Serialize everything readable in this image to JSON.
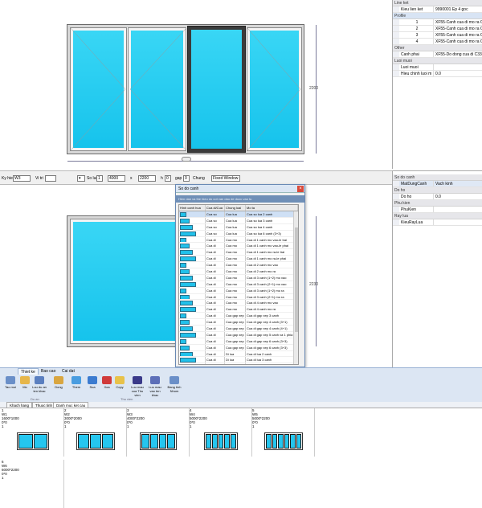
{
  "top_panel": {
    "dim_height": "2200",
    "dim_width_hint": "—"
  },
  "properties_top": {
    "cat_line": "Line ket",
    "rows1": [
      {
        "k": "Kieu lien ket",
        "v": "9990001  Ep 4 goc"
      }
    ],
    "cat_profile": "Profile",
    "rows2": [
      {
        "k": "1",
        "v": "XF55-Canh cua di mo ra  C"
      },
      {
        "k": "2",
        "v": "XF55-Canh cua di mo ra  C"
      },
      {
        "k": "3",
        "v": "XF55-Canh cua di mo ra  C"
      },
      {
        "k": "4",
        "v": "XF55-Canh cua di mo ra  C"
      }
    ],
    "cat_other": "Other",
    "rows3": [
      {
        "k": "Canh phai",
        "v": "XF55-Do dong cua di  C332"
      }
    ],
    "cat_luoi": "Luoi muoi",
    "rows4": [
      {
        "k": "Luoi muoi",
        "v": ""
      },
      {
        "k": "Hieu chinh luoi m",
        "v": "0.0"
      }
    ]
  },
  "toolbar": {
    "ky_hieu_label": "Ky hieu",
    "ky_hieu_value": "W3",
    "vi_tri_label": "Vi tri",
    "so_luong_label": "So luo",
    "so_luong_value": "1",
    "width_value": "4000",
    "x_label": "x",
    "height_value": "2200",
    "h_label": "h",
    "h_value": "0",
    "gap_label": "gap",
    "gap_value": "0",
    "chung_label": "Chung",
    "chung_value": "Fixed Window"
  },
  "bottom_panel": {
    "dim_height": "2230"
  },
  "properties_bottom": {
    "cat_so_do": "So do canh",
    "row_mat": {
      "k": "MatDungCanh",
      "v": "Vach kinh"
    },
    "cat_do_ho": "Do ho",
    "row_do_ho": {
      "k": "Do ho",
      "v": "0.0"
    },
    "cat_phu_kien": "Phu kien",
    "row_phukien": {
      "k": "PhuKien",
      "v": ""
    },
    "cat_ray": "Ray lua",
    "row_ray": {
      "k": "KieuRayLua",
      "v": ""
    }
  },
  "dialog": {
    "title": "So do canh",
    "hint": "Hien dan va the hieu do cot van dau de duoc vao tu",
    "columns": [
      "Hinh canh hua",
      "Cua di/Cua",
      "Chung loai",
      "Mo ta"
    ],
    "rows": [
      [
        "",
        "Cua so",
        "Cua lua",
        "Cua so lua 2 canh"
      ],
      [
        "",
        "Cua so",
        "Cua lua",
        "Cua so lua 3 canh"
      ],
      [
        "",
        "Cua so",
        "Cua lua",
        "Cua so lua 4 canh"
      ],
      [
        "",
        "Cua so",
        "Cua lua",
        "Cua so lua 6 canh (3+3)"
      ],
      [
        "",
        "Cua di",
        "Cua mo",
        "Cua di 1 canh mo vao-le trai"
      ],
      [
        "",
        "Cua di",
        "Cua mo",
        "Cua di 1 canh mo vao-le phai"
      ],
      [
        "",
        "Cua di",
        "Cua mo",
        "Cua di 1 canh mo ra-le trai"
      ],
      [
        "",
        "Cua di",
        "Cua mo",
        "Cua di 1 canh mo ra-le phai"
      ],
      [
        "",
        "Cua di",
        "Cua mo",
        "Cua di 2 canh mo vao"
      ],
      [
        "",
        "Cua di",
        "Cua mo",
        "Cua di 2 canh mo ra"
      ],
      [
        "",
        "Cua di",
        "Cua mo",
        "Cua di 3 canh (1+2) mo vao"
      ],
      [
        "",
        "Cua di",
        "Cua mo",
        "Cua di 3 canh (2+1) mo vao"
      ],
      [
        "",
        "Cua di",
        "Cua mo",
        "Cua di 3 canh (1+2) mo ra"
      ],
      [
        "",
        "Cua di",
        "Cua mo",
        "Cua di 3 canh (2+1) mo ra"
      ],
      [
        "",
        "Cua di",
        "Cua mo",
        "Cua di 4 canh mo vao"
      ],
      [
        "",
        "Cua di",
        "Cua mo",
        "Cua di 4 canh mo ra"
      ],
      [
        "",
        "Cua di",
        "Cua gap xep",
        "Cua di gap xep 3 canh"
      ],
      [
        "",
        "Cua di",
        "Cua gap xep",
        "Cua di gap xep 4 canh (3+1)"
      ],
      [
        "",
        "Cua di",
        "Cua gap xep",
        "Cua di gap xep 4 canh (4+1)"
      ],
      [
        "",
        "Cua di",
        "Cua gap xep",
        "Cua di gap xep 5 canh va 1 phia"
      ],
      [
        "",
        "Cua di",
        "Cua gap xep",
        "Cua di gap xep 6 canh (3+3)"
      ],
      [
        "",
        "Cua di",
        "Cua gap xep",
        "Cua di gap xep 6 canh (3+3)"
      ],
      [
        "",
        "Cua di",
        "Di lua",
        "Cua di lua 2 canh"
      ],
      [
        "",
        "Cua di",
        "Di lua",
        "Cua di lua 3 canh"
      ],
      [
        "",
        "Cua di",
        "Di lua",
        "Cua di lua 4 canh"
      ]
    ]
  },
  "ribbon": {
    "tabs": [
      "Thiet ke",
      "Bao cao",
      "Cai dat"
    ],
    "buttons": [
      {
        "label": "Tao moi",
        "icon": "new-icon",
        "color": "#6a8fc8"
      },
      {
        "label": "Mo",
        "icon": "open-folder-icon",
        "color": "#e6b64a"
      },
      {
        "label": "Luu du an ten khac",
        "icon": "save-as-icon",
        "color": "#5a7fc0"
      },
      {
        "label": "Dong",
        "icon": "close-folder-icon",
        "color": "#d9a640"
      },
      {
        "label": "Them",
        "icon": "add-icon",
        "color": "#4a9de0"
      },
      {
        "label": "Sua",
        "icon": "edit-icon",
        "color": "#3b7bd0"
      },
      {
        "label": "Xoa",
        "icon": "delete-icon",
        "color": "#d03a3a"
      },
      {
        "label": "Copy",
        "icon": "copy-icon",
        "color": "#e8c24a"
      },
      {
        "label": "Luu mau cua Thu vien",
        "icon": "save-library-icon",
        "color": "#3a3a8a"
      },
      {
        "label": "Luu mau vao ten khac",
        "icon": "save-template-icon",
        "color": "#5c6fb8"
      },
      {
        "label": "Bang tinh Nhom",
        "icon": "calc-icon",
        "color": "#6a8fc8"
      }
    ],
    "groups": [
      "Du an",
      "Thu vien"
    ]
  },
  "bottom_tabs": [
    "Khach hang",
    "Thuoc tinh",
    "Danh muc ket cau"
  ],
  "thumbnails": [
    {
      "idx": "1",
      "code": "W1",
      "size": "1600*1000",
      "pos": "0*0",
      "qty": "1",
      "panes": 2
    },
    {
      "idx": "2",
      "code": "W2",
      "size": "3000*2000",
      "pos": "0*0",
      "qty": "1",
      "panes": 3
    },
    {
      "idx": "3",
      "code": "W3",
      "size": "4000*2200",
      "pos": "0*0",
      "qty": "1",
      "panes": 4
    },
    {
      "idx": "4",
      "code": "W4",
      "size": "5000*2200",
      "pos": "0*0",
      "qty": "1",
      "panes": 5
    },
    {
      "idx": "5",
      "code": "W5",
      "size": "5000*2200",
      "pos": "0*0",
      "qty": "1",
      "panes": 6
    },
    {
      "idx": "6",
      "code": "W6",
      "size": "6000*2200",
      "pos": "0*0",
      "qty": "1",
      "panes": 0
    }
  ]
}
